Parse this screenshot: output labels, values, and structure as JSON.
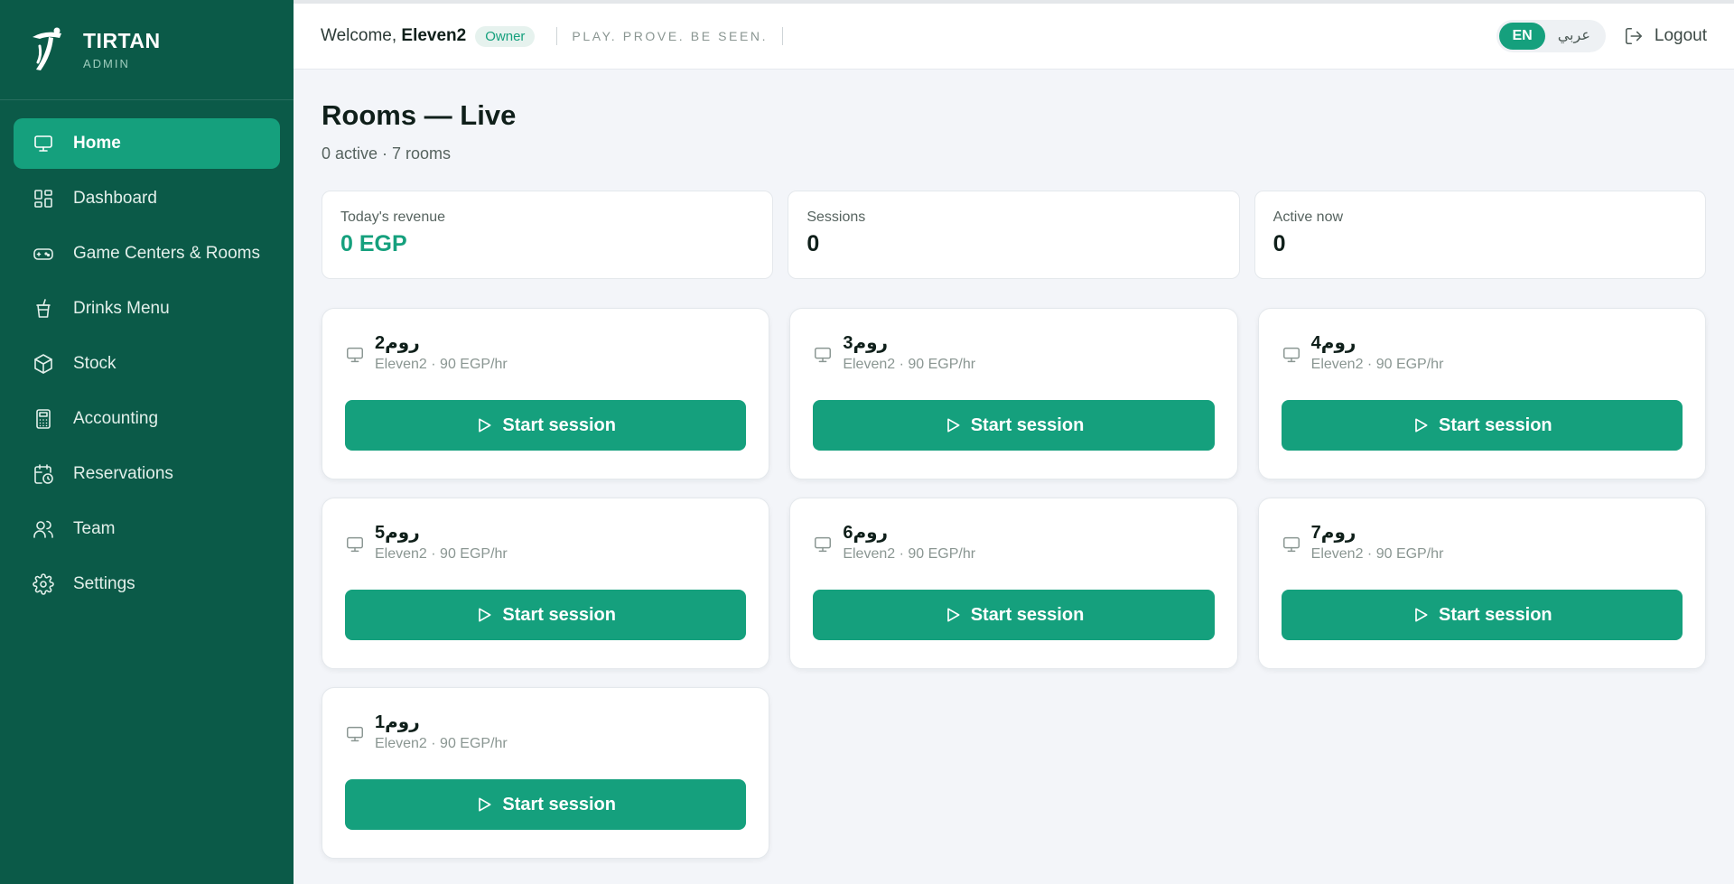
{
  "brand": {
    "name": "TIRTAN",
    "sub": "ADMIN"
  },
  "sidebar": {
    "items": [
      {
        "label": "Home",
        "icon": "monitor-icon",
        "active": true
      },
      {
        "label": "Dashboard",
        "icon": "grid-icon"
      },
      {
        "label": "Game Centers & Rooms",
        "icon": "gamepad-icon"
      },
      {
        "label": "Drinks Menu",
        "icon": "cup-icon"
      },
      {
        "label": "Stock",
        "icon": "box-icon"
      },
      {
        "label": "Accounting",
        "icon": "calculator-icon"
      },
      {
        "label": "Reservations",
        "icon": "calendar-clock-icon"
      },
      {
        "label": "Team",
        "icon": "users-icon"
      },
      {
        "label": "Settings",
        "icon": "gear-icon"
      }
    ]
  },
  "header": {
    "welcome_prefix": "Welcome,",
    "username": "Eleven2",
    "role": "Owner",
    "tagline": "PLAY. PROVE. BE SEEN.",
    "lang_en": "EN",
    "lang_ar": "عربي",
    "logout": "Logout"
  },
  "main": {
    "title": "Rooms — Live",
    "subtitle": "0 active · 7 rooms",
    "stats": [
      {
        "label": "Today's revenue",
        "value": "0 EGP"
      },
      {
        "label": "Sessions",
        "value": "0"
      },
      {
        "label": "Active now",
        "value": "0"
      }
    ],
    "start_label": "Start session",
    "rooms": [
      {
        "name": "روم2",
        "meta": "Eleven2 · 90 EGP/hr"
      },
      {
        "name": "روم3",
        "meta": "Eleven2 · 90 EGP/hr"
      },
      {
        "name": "روم4",
        "meta": "Eleven2 · 90 EGP/hr"
      },
      {
        "name": "روم5",
        "meta": "Eleven2 · 90 EGP/hr"
      },
      {
        "name": "روم6",
        "meta": "Eleven2 · 90 EGP/hr"
      },
      {
        "name": "روم7",
        "meta": "Eleven2 · 90 EGP/hr"
      },
      {
        "name": "روم1",
        "meta": "Eleven2 · 90 EGP/hr"
      }
    ]
  },
  "colors": {
    "sidebar": "#0b5a48",
    "accent": "#15a07d",
    "background": "#f3f5f9"
  }
}
